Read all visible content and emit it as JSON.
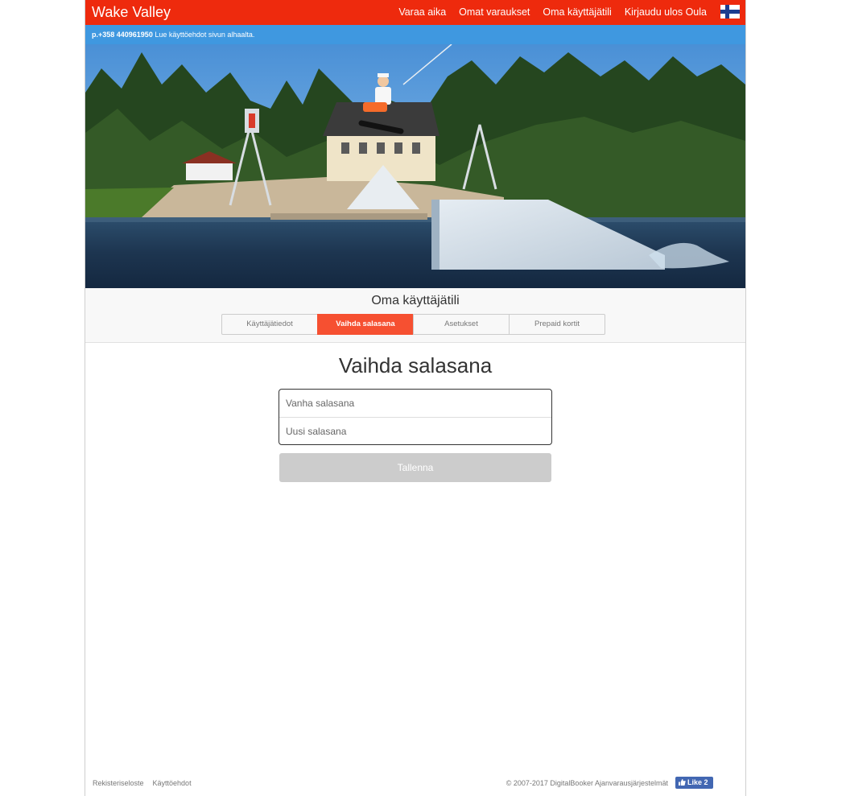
{
  "navbar": {
    "brand": "Wake Valley",
    "links": [
      "Varaa aika",
      "Omat varaukset",
      "Oma käyttäjätili",
      "Kirjaudu ulos Oula"
    ],
    "language_flag": "finland-flag-icon",
    "color": "#ee2a0d"
  },
  "infobar": {
    "phone": "p.+358 440961950",
    "text": "Lue käyttöehdot sivun alhaalta.",
    "color": "#3f98e0"
  },
  "account": {
    "title": "Oma käyttäjätili",
    "tabs": [
      {
        "label": "Käyttäjätiedot",
        "active": false
      },
      {
        "label": "Vaihda salasana",
        "active": true
      },
      {
        "label": "Asetukset",
        "active": false
      },
      {
        "label": "Prepaid kortit",
        "active": false
      }
    ],
    "active_tab_color": "#f65031"
  },
  "form": {
    "title": "Vaihda salasana",
    "old_password_placeholder": "Vanha salasana",
    "new_password_placeholder": "Uusi salasana",
    "old_password_value": "",
    "new_password_value": "",
    "save_label": "Tallenna"
  },
  "footer": {
    "links": [
      "Rekisteriseloste",
      "Käyttöehdot"
    ],
    "copyright": "© 2007-2017 DigitalBooker Ajanvarausjärjestelmät",
    "like_label": "Like 2"
  }
}
